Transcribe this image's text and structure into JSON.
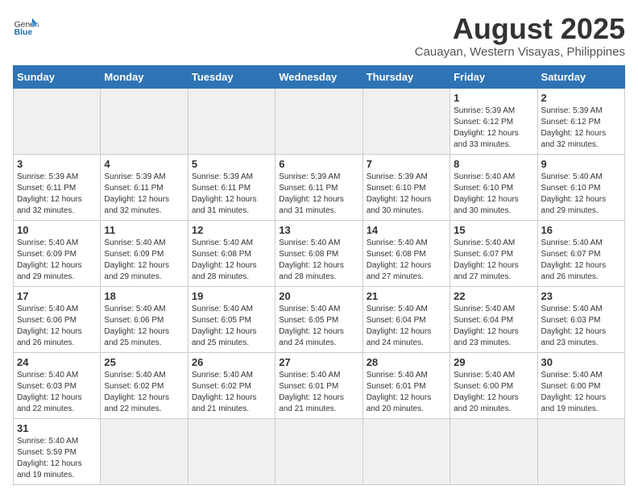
{
  "header": {
    "logo_general": "General",
    "logo_blue": "Blue",
    "title": "August 2025",
    "subtitle": "Cauayan, Western Visayas, Philippines"
  },
  "weekdays": [
    "Sunday",
    "Monday",
    "Tuesday",
    "Wednesday",
    "Thursday",
    "Friday",
    "Saturday"
  ],
  "weeks": [
    [
      {
        "day": "",
        "info": ""
      },
      {
        "day": "",
        "info": ""
      },
      {
        "day": "",
        "info": ""
      },
      {
        "day": "",
        "info": ""
      },
      {
        "day": "",
        "info": ""
      },
      {
        "day": "1",
        "info": "Sunrise: 5:39 AM\nSunset: 6:12 PM\nDaylight: 12 hours\nand 33 minutes."
      },
      {
        "day": "2",
        "info": "Sunrise: 5:39 AM\nSunset: 6:12 PM\nDaylight: 12 hours\nand 32 minutes."
      }
    ],
    [
      {
        "day": "3",
        "info": "Sunrise: 5:39 AM\nSunset: 6:11 PM\nDaylight: 12 hours\nand 32 minutes."
      },
      {
        "day": "4",
        "info": "Sunrise: 5:39 AM\nSunset: 6:11 PM\nDaylight: 12 hours\nand 32 minutes."
      },
      {
        "day": "5",
        "info": "Sunrise: 5:39 AM\nSunset: 6:11 PM\nDaylight: 12 hours\nand 31 minutes."
      },
      {
        "day": "6",
        "info": "Sunrise: 5:39 AM\nSunset: 6:11 PM\nDaylight: 12 hours\nand 31 minutes."
      },
      {
        "day": "7",
        "info": "Sunrise: 5:39 AM\nSunset: 6:10 PM\nDaylight: 12 hours\nand 30 minutes."
      },
      {
        "day": "8",
        "info": "Sunrise: 5:40 AM\nSunset: 6:10 PM\nDaylight: 12 hours\nand 30 minutes."
      },
      {
        "day": "9",
        "info": "Sunrise: 5:40 AM\nSunset: 6:10 PM\nDaylight: 12 hours\nand 29 minutes."
      }
    ],
    [
      {
        "day": "10",
        "info": "Sunrise: 5:40 AM\nSunset: 6:09 PM\nDaylight: 12 hours\nand 29 minutes."
      },
      {
        "day": "11",
        "info": "Sunrise: 5:40 AM\nSunset: 6:09 PM\nDaylight: 12 hours\nand 29 minutes."
      },
      {
        "day": "12",
        "info": "Sunrise: 5:40 AM\nSunset: 6:08 PM\nDaylight: 12 hours\nand 28 minutes."
      },
      {
        "day": "13",
        "info": "Sunrise: 5:40 AM\nSunset: 6:08 PM\nDaylight: 12 hours\nand 28 minutes."
      },
      {
        "day": "14",
        "info": "Sunrise: 5:40 AM\nSunset: 6:08 PM\nDaylight: 12 hours\nand 27 minutes."
      },
      {
        "day": "15",
        "info": "Sunrise: 5:40 AM\nSunset: 6:07 PM\nDaylight: 12 hours\nand 27 minutes."
      },
      {
        "day": "16",
        "info": "Sunrise: 5:40 AM\nSunset: 6:07 PM\nDaylight: 12 hours\nand 26 minutes."
      }
    ],
    [
      {
        "day": "17",
        "info": "Sunrise: 5:40 AM\nSunset: 6:06 PM\nDaylight: 12 hours\nand 26 minutes."
      },
      {
        "day": "18",
        "info": "Sunrise: 5:40 AM\nSunset: 6:06 PM\nDaylight: 12 hours\nand 25 minutes."
      },
      {
        "day": "19",
        "info": "Sunrise: 5:40 AM\nSunset: 6:05 PM\nDaylight: 12 hours\nand 25 minutes."
      },
      {
        "day": "20",
        "info": "Sunrise: 5:40 AM\nSunset: 6:05 PM\nDaylight: 12 hours\nand 24 minutes."
      },
      {
        "day": "21",
        "info": "Sunrise: 5:40 AM\nSunset: 6:04 PM\nDaylight: 12 hours\nand 24 minutes."
      },
      {
        "day": "22",
        "info": "Sunrise: 5:40 AM\nSunset: 6:04 PM\nDaylight: 12 hours\nand 23 minutes."
      },
      {
        "day": "23",
        "info": "Sunrise: 5:40 AM\nSunset: 6:03 PM\nDaylight: 12 hours\nand 23 minutes."
      }
    ],
    [
      {
        "day": "24",
        "info": "Sunrise: 5:40 AM\nSunset: 6:03 PM\nDaylight: 12 hours\nand 22 minutes."
      },
      {
        "day": "25",
        "info": "Sunrise: 5:40 AM\nSunset: 6:02 PM\nDaylight: 12 hours\nand 22 minutes."
      },
      {
        "day": "26",
        "info": "Sunrise: 5:40 AM\nSunset: 6:02 PM\nDaylight: 12 hours\nand 21 minutes."
      },
      {
        "day": "27",
        "info": "Sunrise: 5:40 AM\nSunset: 6:01 PM\nDaylight: 12 hours\nand 21 minutes."
      },
      {
        "day": "28",
        "info": "Sunrise: 5:40 AM\nSunset: 6:01 PM\nDaylight: 12 hours\nand 20 minutes."
      },
      {
        "day": "29",
        "info": "Sunrise: 5:40 AM\nSunset: 6:00 PM\nDaylight: 12 hours\nand 20 minutes."
      },
      {
        "day": "30",
        "info": "Sunrise: 5:40 AM\nSunset: 6:00 PM\nDaylight: 12 hours\nand 19 minutes."
      }
    ],
    [
      {
        "day": "31",
        "info": "Sunrise: 5:40 AM\nSunset: 5:59 PM\nDaylight: 12 hours\nand 19 minutes."
      },
      {
        "day": "",
        "info": ""
      },
      {
        "day": "",
        "info": ""
      },
      {
        "day": "",
        "info": ""
      },
      {
        "day": "",
        "info": ""
      },
      {
        "day": "",
        "info": ""
      },
      {
        "day": "",
        "info": ""
      }
    ]
  ]
}
